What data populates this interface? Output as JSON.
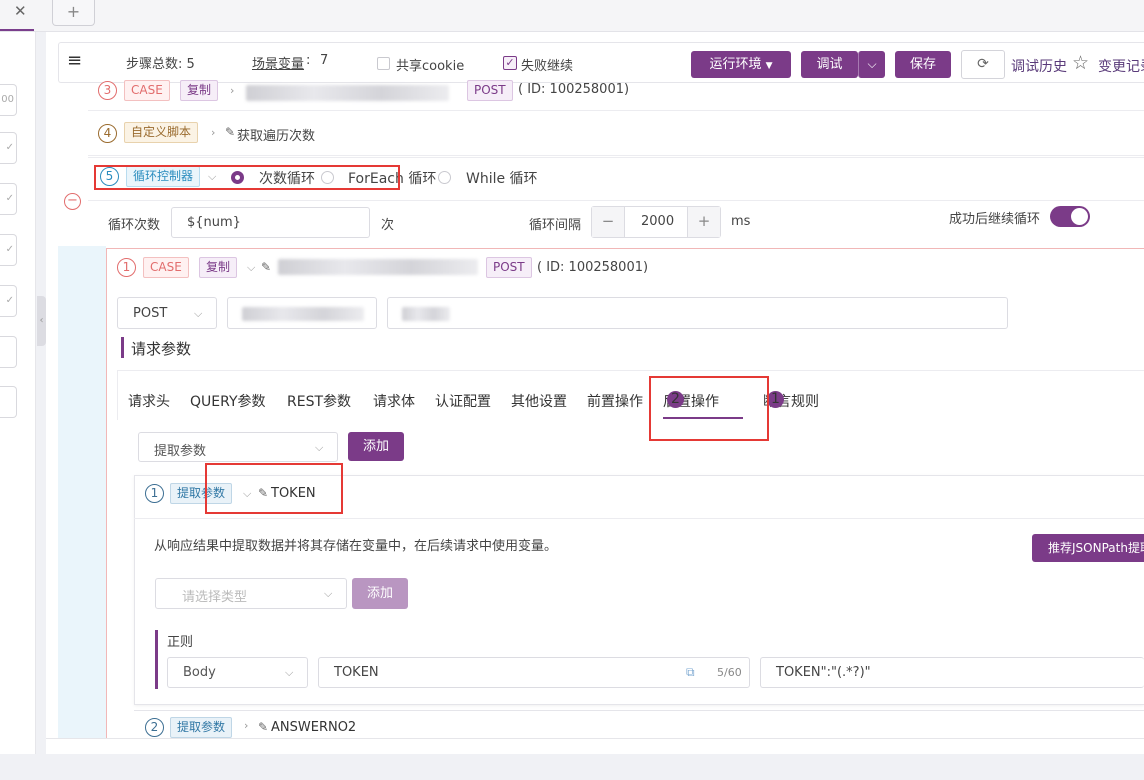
{
  "tabstrip": {
    "close_glyph": "✕",
    "add_glyph": "+"
  },
  "toolbar": {
    "menu_glyph": "≡",
    "steps_label": "步骤总数: 5",
    "vars_label": "场景变量",
    "vars_count": "7",
    "share_cookie": "共享cookie",
    "fail_continue": "失败继续",
    "fail_continue_checked": true,
    "env_button": "运行环境",
    "debug_button": "调试",
    "save_button": "保存",
    "history": "调试历史",
    "changes": "变更记录"
  },
  "steps": {
    "step3": {
      "index": "3",
      "type": "CASE",
      "copy": "复制",
      "method": "POST",
      "id_text": "( ID: 100258001)"
    },
    "step4": {
      "index": "4",
      "type": "自定义脚本",
      "name": "获取遍历次数"
    },
    "step5": {
      "index": "5",
      "type": "循环控制器",
      "loop_modes": [
        "次数循环",
        "ForEach 循环",
        "While 循环"
      ],
      "selected_mode": "次数循环",
      "count_label": "循环次数",
      "count_value": "${num}",
      "count_unit": "次",
      "interval_label": "循环间隔",
      "interval_value": "2000",
      "interval_unit": "ms",
      "continue_label": "成功后继续循环",
      "continue_on": true
    }
  },
  "inner_case": {
    "index": "1",
    "type": "CASE",
    "copy": "复制",
    "method_badge": "POST",
    "id_text": "( ID: 100258001)",
    "method_select": "POST",
    "section_title": "请求参数",
    "tabs": [
      "请求头",
      "QUERY参数",
      "REST参数",
      "请求体",
      "认证配置",
      "其他设置",
      "前置操作",
      "后置操作",
      "断言规则"
    ],
    "active_tab": "后置操作",
    "post_ops_count": "2",
    "assert_count": "1",
    "extract_select": "提取参数",
    "add_button": "添加",
    "extractors": [
      {
        "index": "1",
        "type": "提取参数",
        "name": "TOKEN",
        "description": "从响应结果中提取数据并将其存储在变量中，在后续请求中使用变量。",
        "jsonpath_button": "推荐JSONPath提取",
        "type_placeholder": "请选择类型",
        "add_button": "添加",
        "rule_title": "正则",
        "source": "Body",
        "variable": "TOKEN",
        "char_count": "5/60",
        "expression": "TOKEN\":\"(.*?)\""
      },
      {
        "index": "2",
        "type": "提取参数",
        "name": "ANSWERNO2"
      }
    ]
  },
  "colors": {
    "accent": "#7b3b88",
    "case_red": "#e26d6d",
    "highlight_red": "#e53935"
  }
}
